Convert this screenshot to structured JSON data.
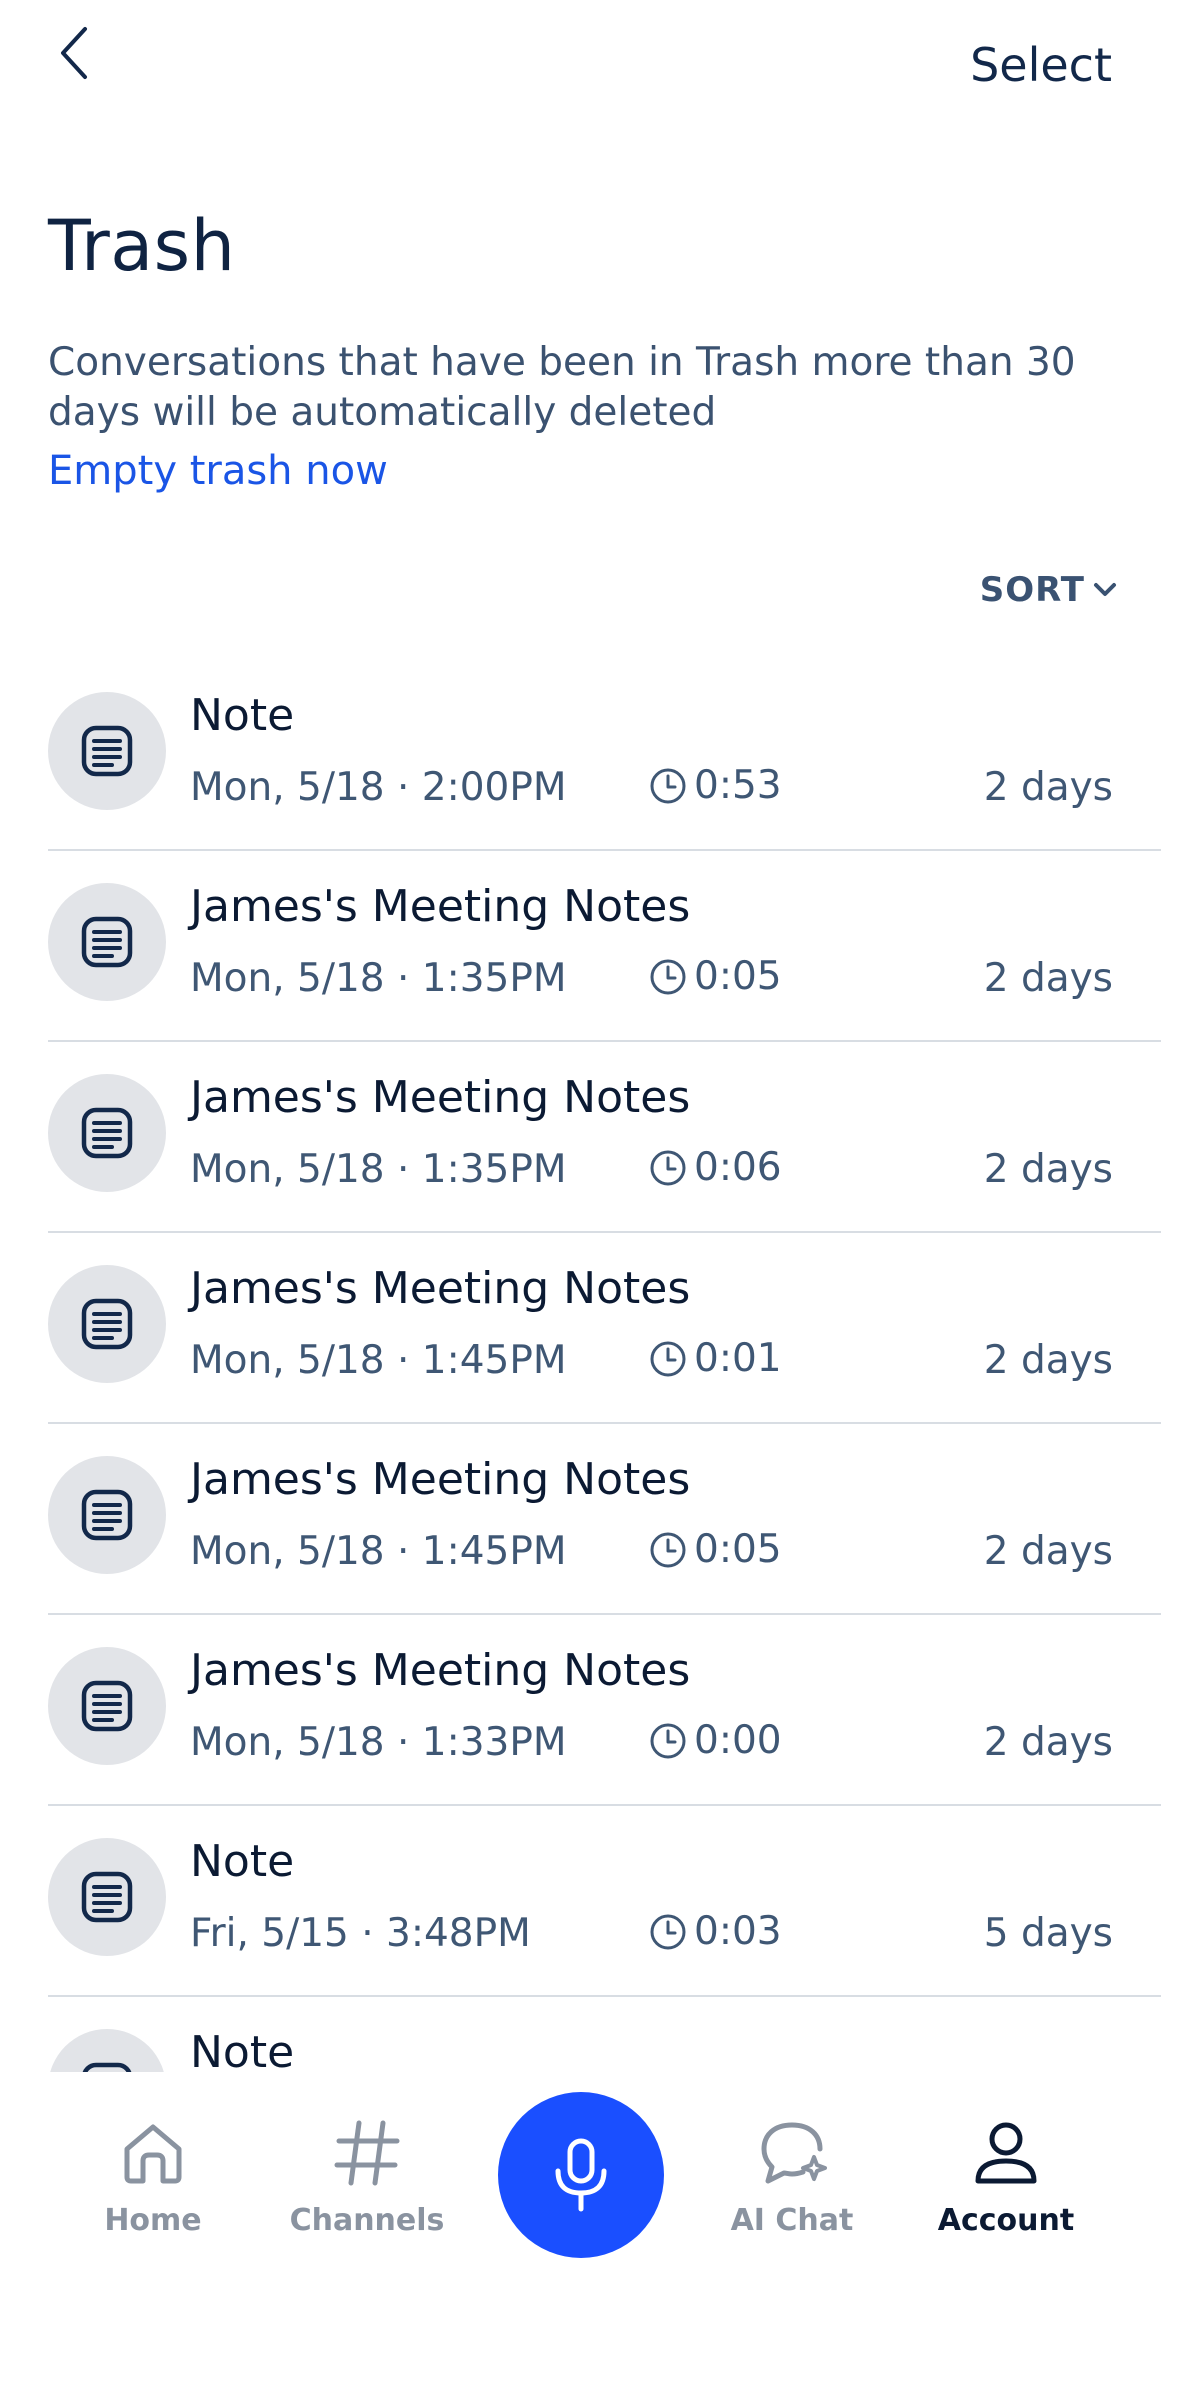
{
  "header": {
    "select_label": "Select",
    "title": "Trash",
    "description": "Conversations that have been in Trash more than 30 days will be automatically deleted",
    "empty_link": "Empty trash now",
    "sort_label": "SORT"
  },
  "items": [
    {
      "title": "Note",
      "date": "Mon, 5/18 · 2:00PM",
      "duration": "0:53",
      "days": "2 days"
    },
    {
      "title": "James's Meeting Notes",
      "date": "Mon, 5/18 · 1:35PM",
      "duration": "0:05",
      "days": "2 days"
    },
    {
      "title": "James's Meeting Notes",
      "date": "Mon, 5/18 · 1:35PM",
      "duration": "0:06",
      "days": "2 days"
    },
    {
      "title": "James's Meeting Notes",
      "date": "Mon, 5/18 · 1:45PM",
      "duration": "0:01",
      "days": "2 days"
    },
    {
      "title": "James's Meeting Notes",
      "date": "Mon, 5/18 · 1:45PM",
      "duration": "0:05",
      "days": "2 days"
    },
    {
      "title": "James's Meeting Notes",
      "date": "Mon, 5/18 · 1:33PM",
      "duration": "0:00",
      "days": "2 days"
    },
    {
      "title": "Note",
      "date": "Fri, 5/15 · 3:48PM",
      "duration": "0:03",
      "days": "5 days"
    },
    {
      "title": "Note",
      "date": "",
      "duration": "",
      "days": ""
    }
  ],
  "nav": {
    "home": "Home",
    "channels": "Channels",
    "ai_chat": "AI Chat",
    "account": "Account"
  },
  "colors": {
    "accent": "#1a4fff",
    "link": "#1a55e6",
    "text_dark": "#0b1a33",
    "text_muted": "#3f5774",
    "icon_bg": "#e2e4e8"
  },
  "icons": {
    "back": "chevron-left-icon",
    "sort": "chevron-down-icon",
    "item": "note-document-icon",
    "duration": "clock-icon",
    "home": "home-icon",
    "channels": "hash-icon",
    "record": "microphone-icon",
    "ai_chat": "chat-sparkle-icon",
    "account": "person-icon"
  }
}
